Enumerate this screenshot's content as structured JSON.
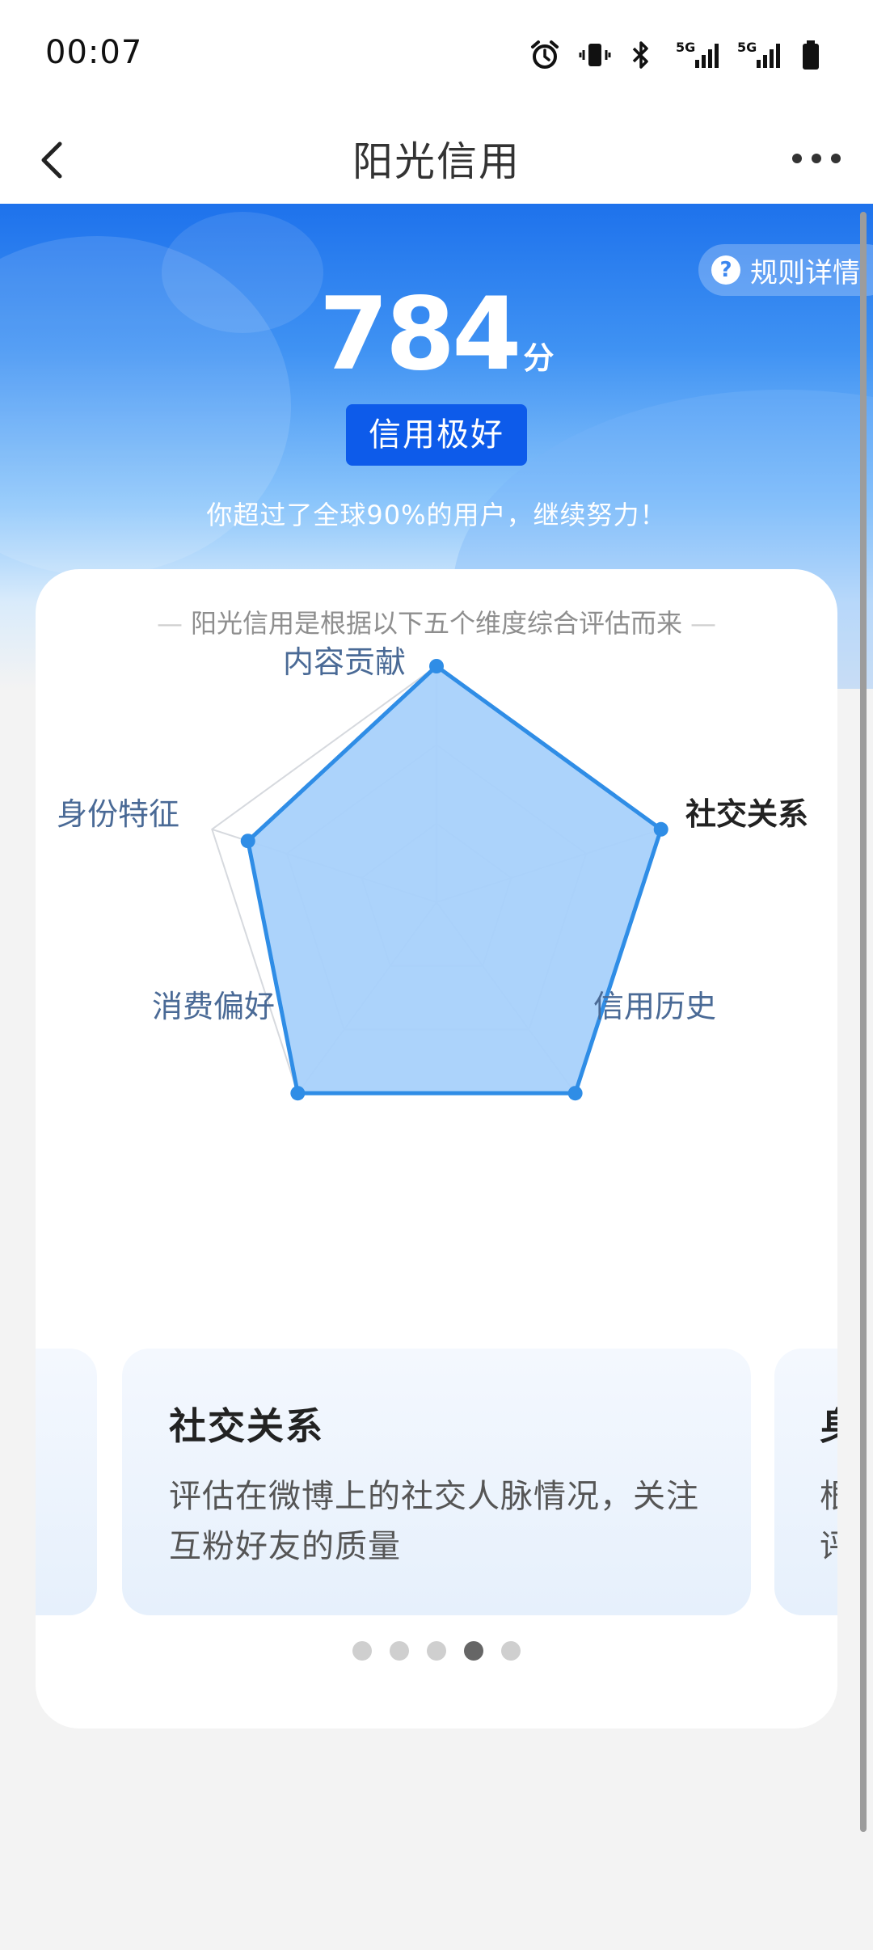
{
  "status": {
    "time": "00:07",
    "icons": [
      "alarm-icon",
      "vibrate-icon",
      "bluetooth-icon",
      "signal-5g-icon",
      "signal-5g-icon",
      "battery-icon"
    ],
    "network_label": "5G"
  },
  "nav": {
    "title": "阳光信用",
    "back_icon": "chevron-left-icon",
    "more_icon": "more-horizontal-icon"
  },
  "hero": {
    "score": "784",
    "score_unit": "分",
    "level": "信用极好",
    "rank_text": "你超过了全球90%的用户，继续努力！",
    "rules_label": "规则详情",
    "rules_icon": "question-icon",
    "rules_icon_glyph": "?"
  },
  "card": {
    "subtitle": "阳光信用是根据以下五个维度综合评估而来",
    "radar": {
      "type": "radar",
      "axes": [
        "内容贡献",
        "社交关系",
        "信用历史",
        "消费偏好",
        "身份特征"
      ],
      "values": [
        1.0,
        1.0,
        1.0,
        1.0,
        0.84
      ],
      "max": 1.0,
      "active_axis": "社交关系",
      "fill_color": "#a8d1fb",
      "line_color": "#2f8de6"
    },
    "carousel": {
      "current": {
        "title": "社交关系",
        "description": "评估在微博上的社交人脉情况，关注互粉好友的质量"
      },
      "next": {
        "title": "身",
        "description": "根\n评"
      },
      "dots": 5,
      "active_dot": 3
    }
  }
}
